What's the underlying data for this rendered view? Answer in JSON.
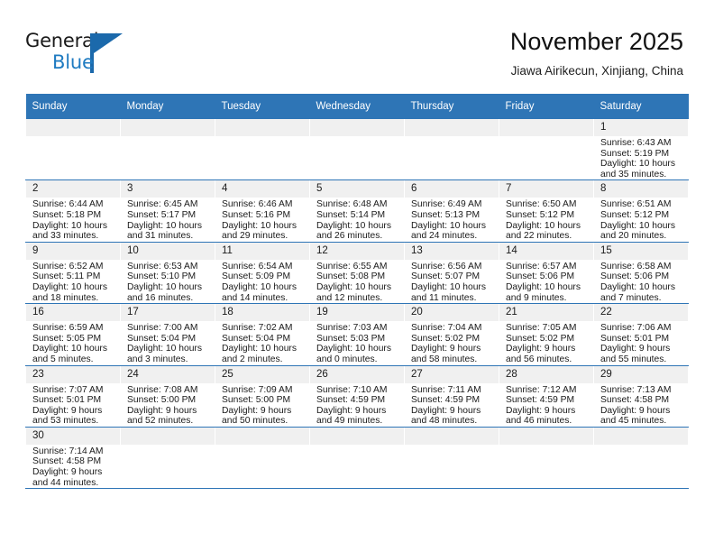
{
  "brand": {
    "name_part1": "General",
    "name_part2": "Blue",
    "logo_icon": "triangle-flag-icon",
    "accent_color": "#1b69ab"
  },
  "header": {
    "title": "November 2025",
    "subtitle": "Jiawa Airikecun, Xinjiang, China",
    "header_bg_color": "#2e75b6"
  },
  "calendar": {
    "weekdays": [
      "Sunday",
      "Monday",
      "Tuesday",
      "Wednesday",
      "Thursday",
      "Friday",
      "Saturday"
    ],
    "weeks": [
      [
        {
          "day": "",
          "empty": true
        },
        {
          "day": "",
          "empty": true
        },
        {
          "day": "",
          "empty": true
        },
        {
          "day": "",
          "empty": true
        },
        {
          "day": "",
          "empty": true
        },
        {
          "day": "",
          "empty": true
        },
        {
          "day": "1",
          "sunrise": "Sunrise: 6:43 AM",
          "sunset": "Sunset: 5:19 PM",
          "daylight1": "Daylight: 10 hours",
          "daylight2": "and 35 minutes."
        }
      ],
      [
        {
          "day": "2",
          "sunrise": "Sunrise: 6:44 AM",
          "sunset": "Sunset: 5:18 PM",
          "daylight1": "Daylight: 10 hours",
          "daylight2": "and 33 minutes."
        },
        {
          "day": "3",
          "sunrise": "Sunrise: 6:45 AM",
          "sunset": "Sunset: 5:17 PM",
          "daylight1": "Daylight: 10 hours",
          "daylight2": "and 31 minutes."
        },
        {
          "day": "4",
          "sunrise": "Sunrise: 6:46 AM",
          "sunset": "Sunset: 5:16 PM",
          "daylight1": "Daylight: 10 hours",
          "daylight2": "and 29 minutes."
        },
        {
          "day": "5",
          "sunrise": "Sunrise: 6:48 AM",
          "sunset": "Sunset: 5:14 PM",
          "daylight1": "Daylight: 10 hours",
          "daylight2": "and 26 minutes."
        },
        {
          "day": "6",
          "sunrise": "Sunrise: 6:49 AM",
          "sunset": "Sunset: 5:13 PM",
          "daylight1": "Daylight: 10 hours",
          "daylight2": "and 24 minutes."
        },
        {
          "day": "7",
          "sunrise": "Sunrise: 6:50 AM",
          "sunset": "Sunset: 5:12 PM",
          "daylight1": "Daylight: 10 hours",
          "daylight2": "and 22 minutes."
        },
        {
          "day": "8",
          "sunrise": "Sunrise: 6:51 AM",
          "sunset": "Sunset: 5:12 PM",
          "daylight1": "Daylight: 10 hours",
          "daylight2": "and 20 minutes."
        }
      ],
      [
        {
          "day": "9",
          "sunrise": "Sunrise: 6:52 AM",
          "sunset": "Sunset: 5:11 PM",
          "daylight1": "Daylight: 10 hours",
          "daylight2": "and 18 minutes."
        },
        {
          "day": "10",
          "sunrise": "Sunrise: 6:53 AM",
          "sunset": "Sunset: 5:10 PM",
          "daylight1": "Daylight: 10 hours",
          "daylight2": "and 16 minutes."
        },
        {
          "day": "11",
          "sunrise": "Sunrise: 6:54 AM",
          "sunset": "Sunset: 5:09 PM",
          "daylight1": "Daylight: 10 hours",
          "daylight2": "and 14 minutes."
        },
        {
          "day": "12",
          "sunrise": "Sunrise: 6:55 AM",
          "sunset": "Sunset: 5:08 PM",
          "daylight1": "Daylight: 10 hours",
          "daylight2": "and 12 minutes."
        },
        {
          "day": "13",
          "sunrise": "Sunrise: 6:56 AM",
          "sunset": "Sunset: 5:07 PM",
          "daylight1": "Daylight: 10 hours",
          "daylight2": "and 11 minutes."
        },
        {
          "day": "14",
          "sunrise": "Sunrise: 6:57 AM",
          "sunset": "Sunset: 5:06 PM",
          "daylight1": "Daylight: 10 hours",
          "daylight2": "and 9 minutes."
        },
        {
          "day": "15",
          "sunrise": "Sunrise: 6:58 AM",
          "sunset": "Sunset: 5:06 PM",
          "daylight1": "Daylight: 10 hours",
          "daylight2": "and 7 minutes."
        }
      ],
      [
        {
          "day": "16",
          "sunrise": "Sunrise: 6:59 AM",
          "sunset": "Sunset: 5:05 PM",
          "daylight1": "Daylight: 10 hours",
          "daylight2": "and 5 minutes."
        },
        {
          "day": "17",
          "sunrise": "Sunrise: 7:00 AM",
          "sunset": "Sunset: 5:04 PM",
          "daylight1": "Daylight: 10 hours",
          "daylight2": "and 3 minutes."
        },
        {
          "day": "18",
          "sunrise": "Sunrise: 7:02 AM",
          "sunset": "Sunset: 5:04 PM",
          "daylight1": "Daylight: 10 hours",
          "daylight2": "and 2 minutes."
        },
        {
          "day": "19",
          "sunrise": "Sunrise: 7:03 AM",
          "sunset": "Sunset: 5:03 PM",
          "daylight1": "Daylight: 10 hours",
          "daylight2": "and 0 minutes."
        },
        {
          "day": "20",
          "sunrise": "Sunrise: 7:04 AM",
          "sunset": "Sunset: 5:02 PM",
          "daylight1": "Daylight: 9 hours",
          "daylight2": "and 58 minutes."
        },
        {
          "day": "21",
          "sunrise": "Sunrise: 7:05 AM",
          "sunset": "Sunset: 5:02 PM",
          "daylight1": "Daylight: 9 hours",
          "daylight2": "and 56 minutes."
        },
        {
          "day": "22",
          "sunrise": "Sunrise: 7:06 AM",
          "sunset": "Sunset: 5:01 PM",
          "daylight1": "Daylight: 9 hours",
          "daylight2": "and 55 minutes."
        }
      ],
      [
        {
          "day": "23",
          "sunrise": "Sunrise: 7:07 AM",
          "sunset": "Sunset: 5:01 PM",
          "daylight1": "Daylight: 9 hours",
          "daylight2": "and 53 minutes."
        },
        {
          "day": "24",
          "sunrise": "Sunrise: 7:08 AM",
          "sunset": "Sunset: 5:00 PM",
          "daylight1": "Daylight: 9 hours",
          "daylight2": "and 52 minutes."
        },
        {
          "day": "25",
          "sunrise": "Sunrise: 7:09 AM",
          "sunset": "Sunset: 5:00 PM",
          "daylight1": "Daylight: 9 hours",
          "daylight2": "and 50 minutes."
        },
        {
          "day": "26",
          "sunrise": "Sunrise: 7:10 AM",
          "sunset": "Sunset: 4:59 PM",
          "daylight1": "Daylight: 9 hours",
          "daylight2": "and 49 minutes."
        },
        {
          "day": "27",
          "sunrise": "Sunrise: 7:11 AM",
          "sunset": "Sunset: 4:59 PM",
          "daylight1": "Daylight: 9 hours",
          "daylight2": "and 48 minutes."
        },
        {
          "day": "28",
          "sunrise": "Sunrise: 7:12 AM",
          "sunset": "Sunset: 4:59 PM",
          "daylight1": "Daylight: 9 hours",
          "daylight2": "and 46 minutes."
        },
        {
          "day": "29",
          "sunrise": "Sunrise: 7:13 AM",
          "sunset": "Sunset: 4:58 PM",
          "daylight1": "Daylight: 9 hours",
          "daylight2": "and 45 minutes."
        }
      ],
      [
        {
          "day": "30",
          "sunrise": "Sunrise: 7:14 AM",
          "sunset": "Sunset: 4:58 PM",
          "daylight1": "Daylight: 9 hours",
          "daylight2": "and 44 minutes."
        },
        {
          "day": "",
          "empty": true
        },
        {
          "day": "",
          "empty": true
        },
        {
          "day": "",
          "empty": true
        },
        {
          "day": "",
          "empty": true
        },
        {
          "day": "",
          "empty": true
        },
        {
          "day": "",
          "empty": true
        }
      ]
    ]
  }
}
